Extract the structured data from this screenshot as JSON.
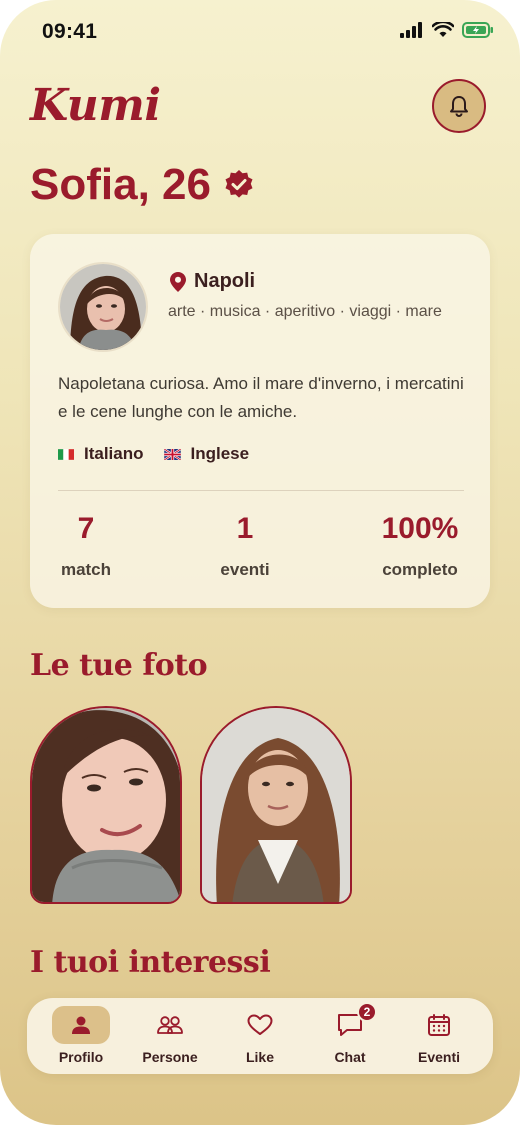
{
  "status_bar": {
    "time": "09:41"
  },
  "header": {
    "brand": "Kumi",
    "name": "Sofia, 26"
  },
  "profile": {
    "location": "Napoli",
    "tags": "arte · musica · aperitivo · viaggi · mare",
    "bio": "Napoletana curiosa. Amo il mare d'inverno, i mercatini e le cene lunghe con le amiche.",
    "languages": [
      {
        "label": "Italiano",
        "flag": "italy-flag-icon"
      },
      {
        "label": "Inglese",
        "flag": "uk-flag-icon"
      }
    ],
    "stats": [
      {
        "value": "7",
        "label": "match"
      },
      {
        "value": "1",
        "label": "eventi"
      },
      {
        "value": "100%",
        "label": "completo"
      }
    ]
  },
  "sections": {
    "photos_title": "Le tue foto",
    "interests_title": "I tuoi interessi"
  },
  "nav": {
    "items": [
      {
        "label": "Profilo",
        "icon": "person-icon",
        "active": true
      },
      {
        "label": "Persone",
        "icon": "people-icon"
      },
      {
        "label": "Like",
        "icon": "heart-icon"
      },
      {
        "label": "Chat",
        "icon": "chat-icon",
        "badge": "2"
      },
      {
        "label": "Eventi",
        "icon": "calendar-icon"
      }
    ]
  },
  "colors": {
    "accent": "#9a1b2c",
    "background": "#efe5b8",
    "card": "#faf6e8"
  }
}
